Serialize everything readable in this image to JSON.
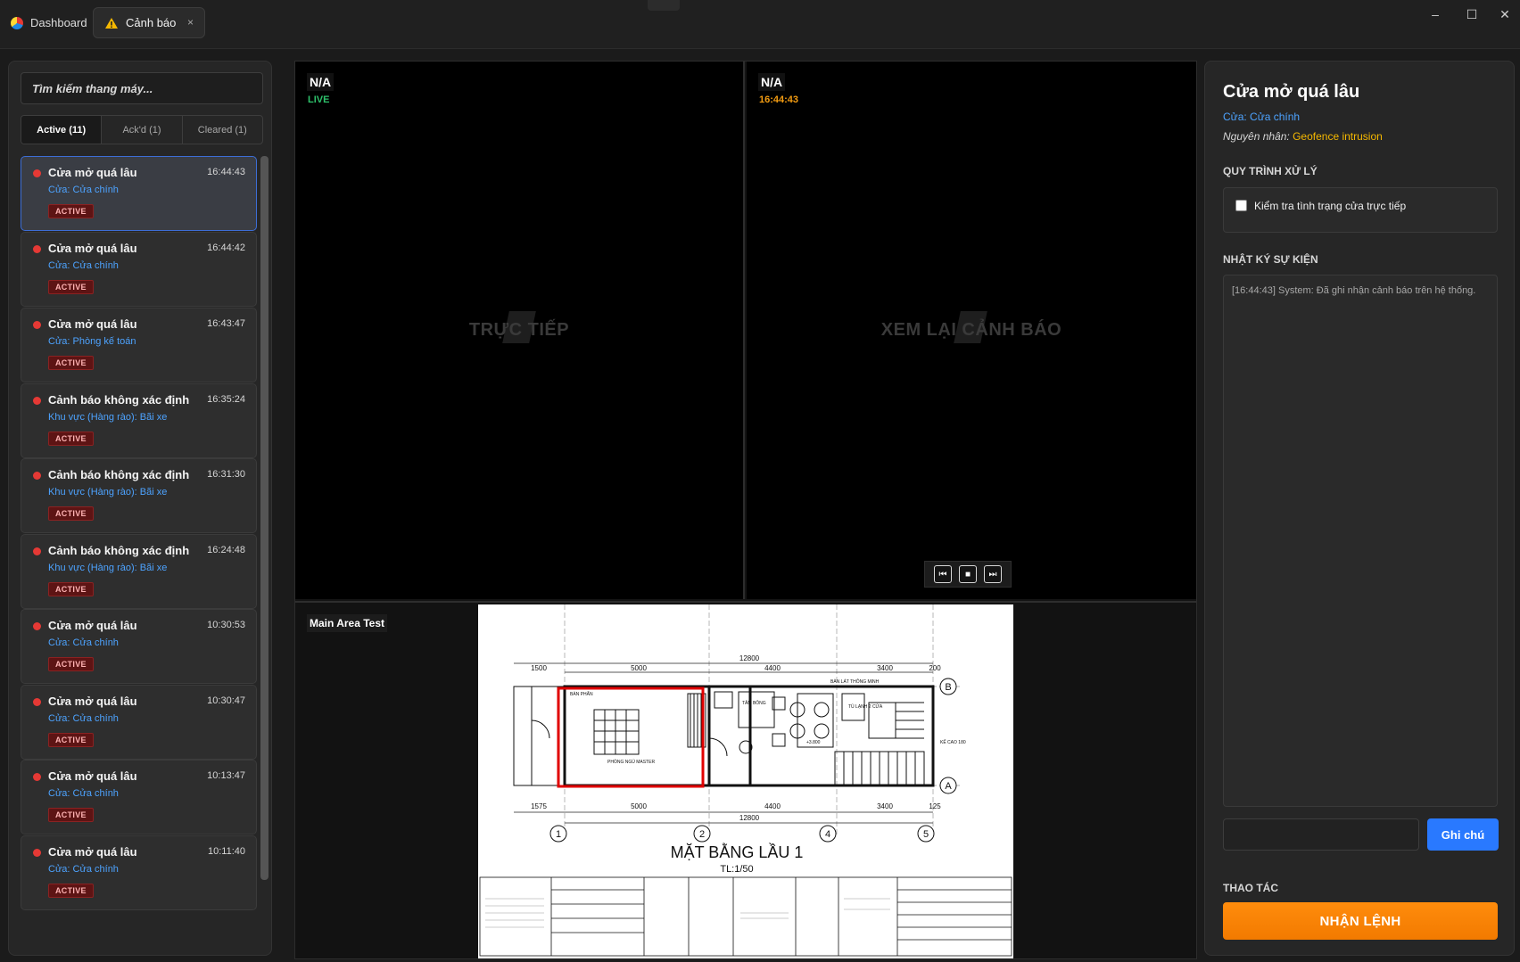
{
  "window": {
    "tabs": [
      {
        "label": "Dashboard",
        "icon": "app-logo-icon"
      },
      {
        "label": "Cảnh báo",
        "icon": "alert-icon",
        "close": "×"
      }
    ],
    "controls": {
      "minimize": "–",
      "maximize": "☐",
      "close": "✕"
    }
  },
  "sidebar": {
    "search_placeholder": "Tìm kiếm thang máy...",
    "filters": [
      "Active (11)",
      "Ack'd (1)",
      "Cleared (1)"
    ],
    "alerts": [
      {
        "title": "Cửa mở quá lâu",
        "time": "16:44:43",
        "sub": "Cửa: Cửa chính",
        "badge": "ACTIVE"
      },
      {
        "title": "Cửa mở quá lâu",
        "time": "16:44:42",
        "sub": "Cửa: Cửa chính",
        "badge": "ACTIVE"
      },
      {
        "title": "Cửa mở quá lâu",
        "time": "16:43:47",
        "sub": "Cửa: Phòng kế toán",
        "badge": "ACTIVE"
      },
      {
        "title": "Cảnh báo không xác định",
        "time": "16:35:24",
        "sub": "Khu vực (Hàng rào): Bãi xe",
        "badge": "ACTIVE"
      },
      {
        "title": "Cảnh báo không xác định",
        "time": "16:31:30",
        "sub": "Khu vực (Hàng rào): Bãi xe",
        "badge": "ACTIVE"
      },
      {
        "title": "Cảnh báo không xác định",
        "time": "16:24:48",
        "sub": "Khu vực (Hàng rào): Bãi xe",
        "badge": "ACTIVE"
      },
      {
        "title": "Cửa mở quá lâu",
        "time": "10:30:53",
        "sub": "Cửa: Cửa chính",
        "badge": "ACTIVE"
      },
      {
        "title": "Cửa mở quá lâu",
        "time": "10:30:47",
        "sub": "Cửa: Cửa chính",
        "badge": "ACTIVE"
      },
      {
        "title": "Cửa mở quá lâu",
        "time": "10:13:47",
        "sub": "Cửa: Cửa chính",
        "badge": "ACTIVE"
      },
      {
        "title": "Cửa mở quá lâu",
        "time": "10:11:40",
        "sub": "Cửa: Cửa chính",
        "badge": "ACTIVE"
      }
    ]
  },
  "video": {
    "live": {
      "camera": "N/A",
      "status": "LIVE",
      "watermark": "TRỰC TIẾP"
    },
    "replay": {
      "camera": "N/A",
      "time": "16:44:43",
      "watermark": "XEM LẠI CẢNH BÁO",
      "controls": {
        "rewind": "⏮",
        "stop": "■",
        "forward": "⏭"
      }
    }
  },
  "map": {
    "name": "Main Area Test",
    "plan_title": "MẶT BẰNG LẦU 1",
    "plan_scale": "TL:1/50",
    "dims_top": [
      "1500",
      "5000",
      "4400",
      "3400",
      "200"
    ],
    "dims_total": "12800",
    "dims_bottom": [
      "1575",
      "5000",
      "4400",
      "3400",
      "125"
    ],
    "axis_cols": [
      "1",
      "2",
      "4",
      "5"
    ],
    "axis_rows": [
      "B",
      "A"
    ],
    "room_labels": [
      "BÀN PHẤN",
      "PHÒNG NGỦ MASTER",
      "TĂM BÔNG",
      "BÀN LÁT THÔNG MINH",
      "TỦ LẠNH 2 CỬA",
      "+3.800",
      "KẾ CAO 180"
    ],
    "highlight_color": "#e00000"
  },
  "detail": {
    "title": "Cửa mở quá lâu",
    "door": "Cửa: Cửa chính",
    "cause_label": "Nguyên nhân:",
    "cause_value": "Geofence intrusion",
    "process_heading": "QUY TRÌNH XỬ LÝ",
    "checklist": [
      "Kiểm tra tình trạng cửa trực tiếp"
    ],
    "log_heading": "NHẬT KÝ SỰ KIỆN",
    "log": "[16:44:43] System: Đã ghi nhận cảnh báo trên hệ thống.",
    "note_button": "Ghi chú",
    "actions_heading": "THAO TÁC",
    "ack_button": "NHẬN LỆNH"
  },
  "colors": {
    "accent_blue": "#2979ff",
    "alert_red": "#e53935",
    "action_orange": "#f27a00",
    "live_green": "#2ec26b",
    "time_amber": "#f39c12"
  }
}
